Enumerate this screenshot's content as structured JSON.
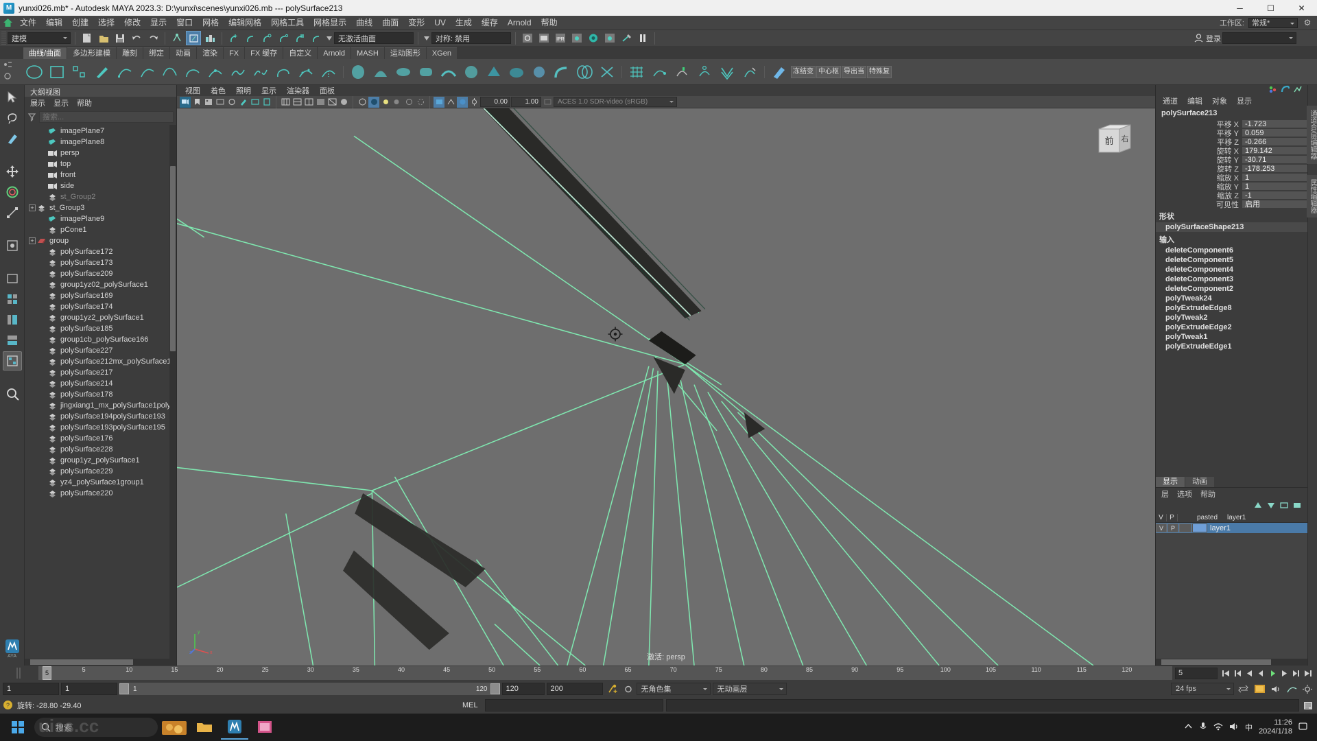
{
  "titlebar": {
    "text": "yunxi026.mb* - Autodesk MAYA 2023.3: D:\\yunxi\\scenes\\yunxi026.mb   ---   polySurface213",
    "minimize": "─",
    "maximize": "☐",
    "close": "✕"
  },
  "menubar": {
    "items": [
      "文件",
      "编辑",
      "创建",
      "选择",
      "修改",
      "显示",
      "窗口",
      "网格",
      "编辑网格",
      "网格工具",
      "网格显示",
      "曲线",
      "曲面",
      "变形",
      "UV",
      "生成",
      "缓存",
      "Arnold",
      "帮助"
    ],
    "workspace_label": "工作区:",
    "workspace_value": "常规*"
  },
  "statusbar": {
    "mode": "建模",
    "no_active_curve": "无激活曲面",
    "symmetry": "对称: 禁用",
    "login": "登录",
    "frame_a": "0.00",
    "frame_b": "1.00"
  },
  "shelf": {
    "tabs": [
      "曲线/曲面",
      "多边形建模",
      "雕刻",
      "绑定",
      "动画",
      "渲染",
      "FX",
      "FX 缓存",
      "自定义",
      "Arnold",
      "MASH",
      "运动图形",
      "XGen"
    ],
    "active_tab": "曲线/曲面",
    "text_buttons": [
      "冻结变",
      "中心枢",
      "导出当",
      "特殊复"
    ]
  },
  "outliner": {
    "title": "大纲视图",
    "menu": [
      "展示",
      "显示",
      "帮助"
    ],
    "search_placeholder": "搜索...",
    "items": [
      {
        "label": "imagePlane7",
        "icon": "image-plane-icon",
        "indent": 1,
        "expand": false,
        "dim": false
      },
      {
        "label": "imagePlane8",
        "icon": "image-plane-icon",
        "indent": 1,
        "expand": false,
        "dim": false
      },
      {
        "label": "persp",
        "icon": "camera-icon",
        "indent": 1,
        "expand": false,
        "dim": false
      },
      {
        "label": "top",
        "icon": "camera-icon",
        "indent": 1,
        "expand": false,
        "dim": false
      },
      {
        "label": "front",
        "icon": "camera-icon",
        "indent": 1,
        "expand": false,
        "dim": false
      },
      {
        "label": "side",
        "icon": "camera-icon",
        "indent": 1,
        "expand": false,
        "dim": false
      },
      {
        "label": "st_Group2",
        "icon": "mesh-icon",
        "indent": 1,
        "expand": false,
        "dim": true
      },
      {
        "label": "st_Group3",
        "icon": "mesh-icon",
        "indent": 0,
        "expand": true,
        "dim": false
      },
      {
        "label": "imagePlane9",
        "icon": "image-plane-icon",
        "indent": 1,
        "expand": false,
        "dim": false
      },
      {
        "label": "pCone1",
        "icon": "mesh-icon",
        "indent": 1,
        "expand": false,
        "dim": false
      },
      {
        "label": "group",
        "icon": "group-icon",
        "indent": 0,
        "expand": true,
        "dim": false
      },
      {
        "label": "polySurface172",
        "icon": "mesh-icon",
        "indent": 1,
        "expand": false,
        "dim": false
      },
      {
        "label": "polySurface173",
        "icon": "mesh-icon",
        "indent": 1,
        "expand": false,
        "dim": false
      },
      {
        "label": "polySurface209",
        "icon": "mesh-icon",
        "indent": 1,
        "expand": false,
        "dim": false
      },
      {
        "label": "group1yz02_polySurface1",
        "icon": "mesh-icon",
        "indent": 1,
        "expand": false,
        "dim": false
      },
      {
        "label": "polySurface169",
        "icon": "mesh-icon",
        "indent": 1,
        "expand": false,
        "dim": false
      },
      {
        "label": "polySurface174",
        "icon": "mesh-icon",
        "indent": 1,
        "expand": false,
        "dim": false
      },
      {
        "label": "group1yz2_polySurface1",
        "icon": "mesh-icon",
        "indent": 1,
        "expand": false,
        "dim": false
      },
      {
        "label": "polySurface185",
        "icon": "mesh-icon",
        "indent": 1,
        "expand": false,
        "dim": false
      },
      {
        "label": "group1cb_polySurface166",
        "icon": "mesh-icon",
        "indent": 1,
        "expand": false,
        "dim": false
      },
      {
        "label": "polySurface227",
        "icon": "mesh-icon",
        "indent": 1,
        "expand": false,
        "dim": false
      },
      {
        "label": "polySurface212mx_polySurface1",
        "icon": "mesh-icon",
        "indent": 1,
        "expand": false,
        "dim": false
      },
      {
        "label": "polySurface217",
        "icon": "mesh-icon",
        "indent": 1,
        "expand": false,
        "dim": false
      },
      {
        "label": "polySurface214",
        "icon": "mesh-icon",
        "indent": 1,
        "expand": false,
        "dim": false
      },
      {
        "label": "polySurface178",
        "icon": "mesh-icon",
        "indent": 1,
        "expand": false,
        "dim": false
      },
      {
        "label": "jingxiang1_mx_polySurface1poly",
        "icon": "mesh-icon",
        "indent": 1,
        "expand": false,
        "dim": false
      },
      {
        "label": "polySurface194polySurface193",
        "icon": "mesh-icon",
        "indent": 1,
        "expand": false,
        "dim": false
      },
      {
        "label": "polySurface193polySurface195",
        "icon": "mesh-icon",
        "indent": 1,
        "expand": false,
        "dim": false
      },
      {
        "label": "polySurface176",
        "icon": "mesh-icon",
        "indent": 1,
        "expand": false,
        "dim": false
      },
      {
        "label": "polySurface228",
        "icon": "mesh-icon",
        "indent": 1,
        "expand": false,
        "dim": false
      },
      {
        "label": "group1yz_polySurface1",
        "icon": "mesh-icon",
        "indent": 1,
        "expand": false,
        "dim": false
      },
      {
        "label": "polySurface229",
        "icon": "mesh-icon",
        "indent": 1,
        "expand": false,
        "dim": false
      },
      {
        "label": "yz4_polySurface1group1",
        "icon": "mesh-icon",
        "indent": 1,
        "expand": false,
        "dim": false
      },
      {
        "label": "polySurface220",
        "icon": "mesh-icon",
        "indent": 1,
        "expand": false,
        "dim": false
      }
    ]
  },
  "viewport": {
    "menu": [
      "视图",
      "着色",
      "照明",
      "显示",
      "渲染器",
      "面板"
    ],
    "exposure": "0.00",
    "gamma": "1.00",
    "color_space": "ACES 1.0 SDR-video (sRGB)",
    "caption": "激活: persp",
    "cube_front": "前",
    "cube_right": "右",
    "axis_labels": {
      "x": "x",
      "y": "y",
      "z": "z"
    }
  },
  "channelbox": {
    "menu": [
      "通道",
      "编辑",
      "对象",
      "显示"
    ],
    "object_name": "polySurface213",
    "attributes": [
      {
        "label": "平移 X",
        "value": "-1.723"
      },
      {
        "label": "平移 Y",
        "value": "0.059"
      },
      {
        "label": "平移 Z",
        "value": "-0.266"
      },
      {
        "label": "旋转 X",
        "value": "179.142"
      },
      {
        "label": "旋转 Y",
        "value": "-30.71"
      },
      {
        "label": "旋转 Z",
        "value": "-178.253"
      },
      {
        "label": "缩放 X",
        "value": "1"
      },
      {
        "label": "缩放 Y",
        "value": "1"
      },
      {
        "label": "缩放 Z",
        "value": "-1"
      },
      {
        "label": "可见性",
        "value": "启用"
      }
    ],
    "shape_section": "形状",
    "shape_name": "polySurfaceShape213",
    "inputs_section": "输入",
    "inputs": [
      "deleteComponent6",
      "deleteComponent5",
      "deleteComponent4",
      "deleteComponent3",
      "deleteComponent2",
      "polyTweak24",
      "polyExtrudeEdge8",
      "polyTweak2",
      "polyExtrudeEdge2",
      "polyTweak1",
      "polyExtrudeEdge1"
    ],
    "vertical_tabs": [
      "通道合/层编辑器",
      "属性编辑器"
    ]
  },
  "layereditor": {
    "tabs": [
      "显示",
      "动画"
    ],
    "active_tab": "显示",
    "menu": [
      "层",
      "选项",
      "帮助"
    ],
    "col_v": "V",
    "col_p": "P",
    "pasted_label": "pasted",
    "pasted_layer": "layer1",
    "rows": [
      {
        "v": "V",
        "p": "P",
        "name": "layer1",
        "selected": true
      }
    ]
  },
  "timeline": {
    "current_frame": "5",
    "ticks": [
      "5",
      "10",
      "15",
      "20",
      "25",
      "30",
      "35",
      "40",
      "45",
      "50",
      "55",
      "60",
      "65",
      "70",
      "75",
      "80",
      "85",
      "90",
      "95",
      "100",
      "105",
      "110",
      "115",
      "120"
    ],
    "frame_field": "5"
  },
  "range": {
    "start": "1",
    "anim_start": "1",
    "playback_start": "1",
    "playback_end": "120",
    "range_end": "120",
    "anim_end": "200",
    "char_set": "无角色集",
    "anim_layer": "无动画层",
    "fps": "24 fps"
  },
  "commandline": {
    "status_text": "旋转: -28.80    -29.40",
    "mel_label": "MEL"
  },
  "taskbar": {
    "search_placeholder": "搜索",
    "time": "11:26",
    "date": "2024/1/18",
    "ime": "中",
    "watermark": "uiss.cc"
  },
  "colors": {
    "accent": "#4d7ea8",
    "wireframe": "#7fe8b0",
    "panel_bg": "#3c3c3c",
    "viewport_bg": "#6e6e6e",
    "field_bg": "#2e2e2e",
    "selection": "#4a7aa8"
  }
}
